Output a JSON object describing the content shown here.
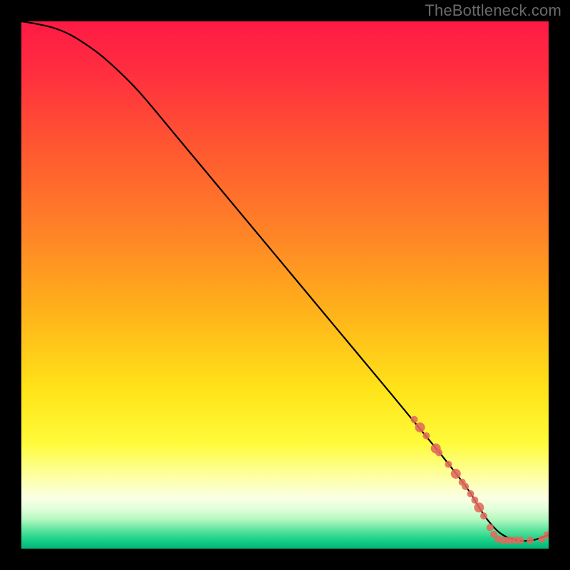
{
  "watermark": "TheBottleneck.com",
  "gradient": {
    "stops": [
      {
        "offset": 0.0,
        "color": "#ff1a44"
      },
      {
        "offset": 0.1,
        "color": "#ff2f3f"
      },
      {
        "offset": 0.25,
        "color": "#ff5a30"
      },
      {
        "offset": 0.4,
        "color": "#ff8327"
      },
      {
        "offset": 0.55,
        "color": "#ffb21a"
      },
      {
        "offset": 0.7,
        "color": "#ffe419"
      },
      {
        "offset": 0.8,
        "color": "#fffb3a"
      },
      {
        "offset": 0.865,
        "color": "#feffa7"
      },
      {
        "offset": 0.905,
        "color": "#faffe6"
      },
      {
        "offset": 0.925,
        "color": "#e0ffd8"
      },
      {
        "offset": 0.945,
        "color": "#b3f7c0"
      },
      {
        "offset": 0.965,
        "color": "#5be49e"
      },
      {
        "offset": 0.985,
        "color": "#13cf85"
      },
      {
        "offset": 1.0,
        "color": "#08b37a"
      }
    ]
  },
  "chart_data": {
    "type": "line",
    "title": "",
    "xlabel": "",
    "ylabel": "",
    "xlim": [
      0,
      100
    ],
    "ylim": [
      0,
      100
    ],
    "series": [
      {
        "name": "curve",
        "x": [
          0,
          3,
          6,
          9,
          12,
          16,
          22,
          30,
          40,
          50,
          60,
          70,
          78,
          82,
          85,
          88,
          91,
          94,
          97,
          100
        ],
        "y": [
          100,
          99.5,
          98.8,
          97.6,
          95.8,
          92.8,
          87.0,
          77.5,
          65.5,
          53.5,
          41.5,
          29.5,
          19.8,
          14.8,
          10.8,
          6.0,
          2.8,
          1.6,
          1.6,
          2.6
        ]
      }
    ],
    "markers": {
      "name": "highlight-points",
      "color": "#e2695b",
      "points": [
        {
          "x": 74.5,
          "y": 24.5,
          "r": 5
        },
        {
          "x": 75.6,
          "y": 23.0,
          "r": 7
        },
        {
          "x": 76.8,
          "y": 21.4,
          "r": 5
        },
        {
          "x": 78.6,
          "y": 19.0,
          "r": 7
        },
        {
          "x": 79.2,
          "y": 18.2,
          "r": 5
        },
        {
          "x": 81.0,
          "y": 16.0,
          "r": 5
        },
        {
          "x": 82.4,
          "y": 14.2,
          "r": 7
        },
        {
          "x": 83.6,
          "y": 12.6,
          "r": 5
        },
        {
          "x": 84.2,
          "y": 11.8,
          "r": 5
        },
        {
          "x": 85.2,
          "y": 10.4,
          "r": 5
        },
        {
          "x": 86.0,
          "y": 9.2,
          "r": 5
        },
        {
          "x": 86.8,
          "y": 7.8,
          "r": 7
        },
        {
          "x": 87.7,
          "y": 6.2,
          "r": 5
        },
        {
          "x": 88.9,
          "y": 4.0,
          "r": 5
        },
        {
          "x": 89.6,
          "y": 2.7,
          "r": 5
        },
        {
          "x": 90.4,
          "y": 1.8,
          "r": 5
        },
        {
          "x": 91.3,
          "y": 1.6,
          "r": 5
        },
        {
          "x": 92.2,
          "y": 1.6,
          "r": 5
        },
        {
          "x": 93.0,
          "y": 1.6,
          "r": 5
        },
        {
          "x": 93.9,
          "y": 1.6,
          "r": 5
        },
        {
          "x": 94.7,
          "y": 1.6,
          "r": 5
        },
        {
          "x": 96.5,
          "y": 1.6,
          "r": 5
        },
        {
          "x": 98.7,
          "y": 1.8,
          "r": 5
        },
        {
          "x": 99.7,
          "y": 2.6,
          "r": 5
        }
      ]
    }
  }
}
